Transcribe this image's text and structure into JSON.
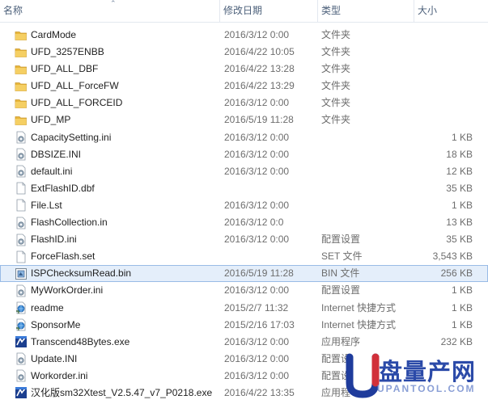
{
  "header": {
    "name": "名称",
    "date": "修改日期",
    "type": "类型",
    "size": "大小"
  },
  "files": [
    {
      "icon": "folder-icon",
      "name": "CardMode",
      "date": "2016/3/12 0:00",
      "type": "文件夹",
      "size": ""
    },
    {
      "icon": "folder-icon",
      "name": "UFD_3257ENBB",
      "date": "2016/4/22 10:05",
      "type": "文件夹",
      "size": ""
    },
    {
      "icon": "folder-icon",
      "name": "UFD_ALL_DBF",
      "date": "2016/4/22 13:28",
      "type": "文件夹",
      "size": ""
    },
    {
      "icon": "folder-icon",
      "name": "UFD_ALL_ForceFW",
      "date": "2016/4/22 13:29",
      "type": "文件夹",
      "size": ""
    },
    {
      "icon": "folder-icon",
      "name": "UFD_ALL_FORCEID",
      "date": "2016/3/12 0:00",
      "type": "文件夹",
      "size": ""
    },
    {
      "icon": "folder-icon",
      "name": "UFD_MP",
      "date": "2016/5/19 11:28",
      "type": "文件夹",
      "size": ""
    },
    {
      "icon": "settings-file-icon",
      "name": "CapacitySetting.ini",
      "date": "2016/3/12 0:00",
      "type": "",
      "size": "1 KB"
    },
    {
      "icon": "settings-file-icon",
      "name": "DBSIZE.INI",
      "date": "2016/3/12 0:00",
      "type": "",
      "size": "18 KB"
    },
    {
      "icon": "settings-file-icon",
      "name": "default.ini",
      "date": "2016/3/12 0:00",
      "type": "",
      "size": "12 KB"
    },
    {
      "icon": "file-icon",
      "name": "ExtFlashID.dbf",
      "date": "",
      "type": "",
      "size": "35 KB"
    },
    {
      "icon": "file-icon",
      "name": "File.Lst",
      "date": "2016/3/12 0:00",
      "type": "",
      "size": "1 KB"
    },
    {
      "icon": "settings-file-icon",
      "name": "FlashCollection.in",
      "date": "2016/3/12 0:0",
      "type": "",
      "size": "13 KB"
    },
    {
      "icon": "settings-file-icon",
      "name": "FlashID.ini",
      "date": "2016/3/12 0:00",
      "type": "配置设置",
      "size": "35 KB"
    },
    {
      "icon": "file-icon",
      "name": "ForceFlash.set",
      "date": "",
      "type": "SET 文件",
      "size": "3,543 KB"
    },
    {
      "icon": "bin-file-icon",
      "name": "ISPChecksumRead.bin",
      "date": "2016/5/19 11:28",
      "type": "BIN 文件",
      "size": "256 KB",
      "selected": true
    },
    {
      "icon": "settings-file-icon",
      "name": "MyWorkOrder.ini",
      "date": "2016/3/12 0:00",
      "type": "配置设置",
      "size": "1 KB"
    },
    {
      "icon": "internet-shortcut-icon",
      "name": "readme",
      "date": "2015/2/7 11:32",
      "type": "Internet 快捷方式",
      "size": "1 KB"
    },
    {
      "icon": "internet-shortcut-icon",
      "name": "SponsorMe",
      "date": "2015/2/16 17:03",
      "type": "Internet 快捷方式",
      "size": "1 KB"
    },
    {
      "icon": "app-icon",
      "name": "Transcend48Bytes.exe",
      "date": "2016/3/12 0:00",
      "type": "应用程序",
      "size": "232 KB"
    },
    {
      "icon": "settings-file-icon",
      "name": "Update.INI",
      "date": "2016/3/12 0:00",
      "type": "配置设",
      "size": ""
    },
    {
      "icon": "settings-file-icon",
      "name": "Workorder.ini",
      "date": "2016/3/12 0:00",
      "type": "配置设",
      "size": ""
    },
    {
      "icon": "app-icon",
      "name": "汉化版sm32Xtest_V2.5.47_v7_P0218.exe",
      "date": "2016/4/22 13:35",
      "type": "应用程",
      "size": ""
    }
  ],
  "watermark": {
    "text": "盘量产网",
    "sub": "UPANTOOL.COM"
  },
  "colors": {
    "folder": "#e8b73c",
    "selection": "#e4eefa",
    "selection_border": "#99bbe6",
    "header_text": "#4c607a",
    "watermark": "#2b4aa8"
  }
}
